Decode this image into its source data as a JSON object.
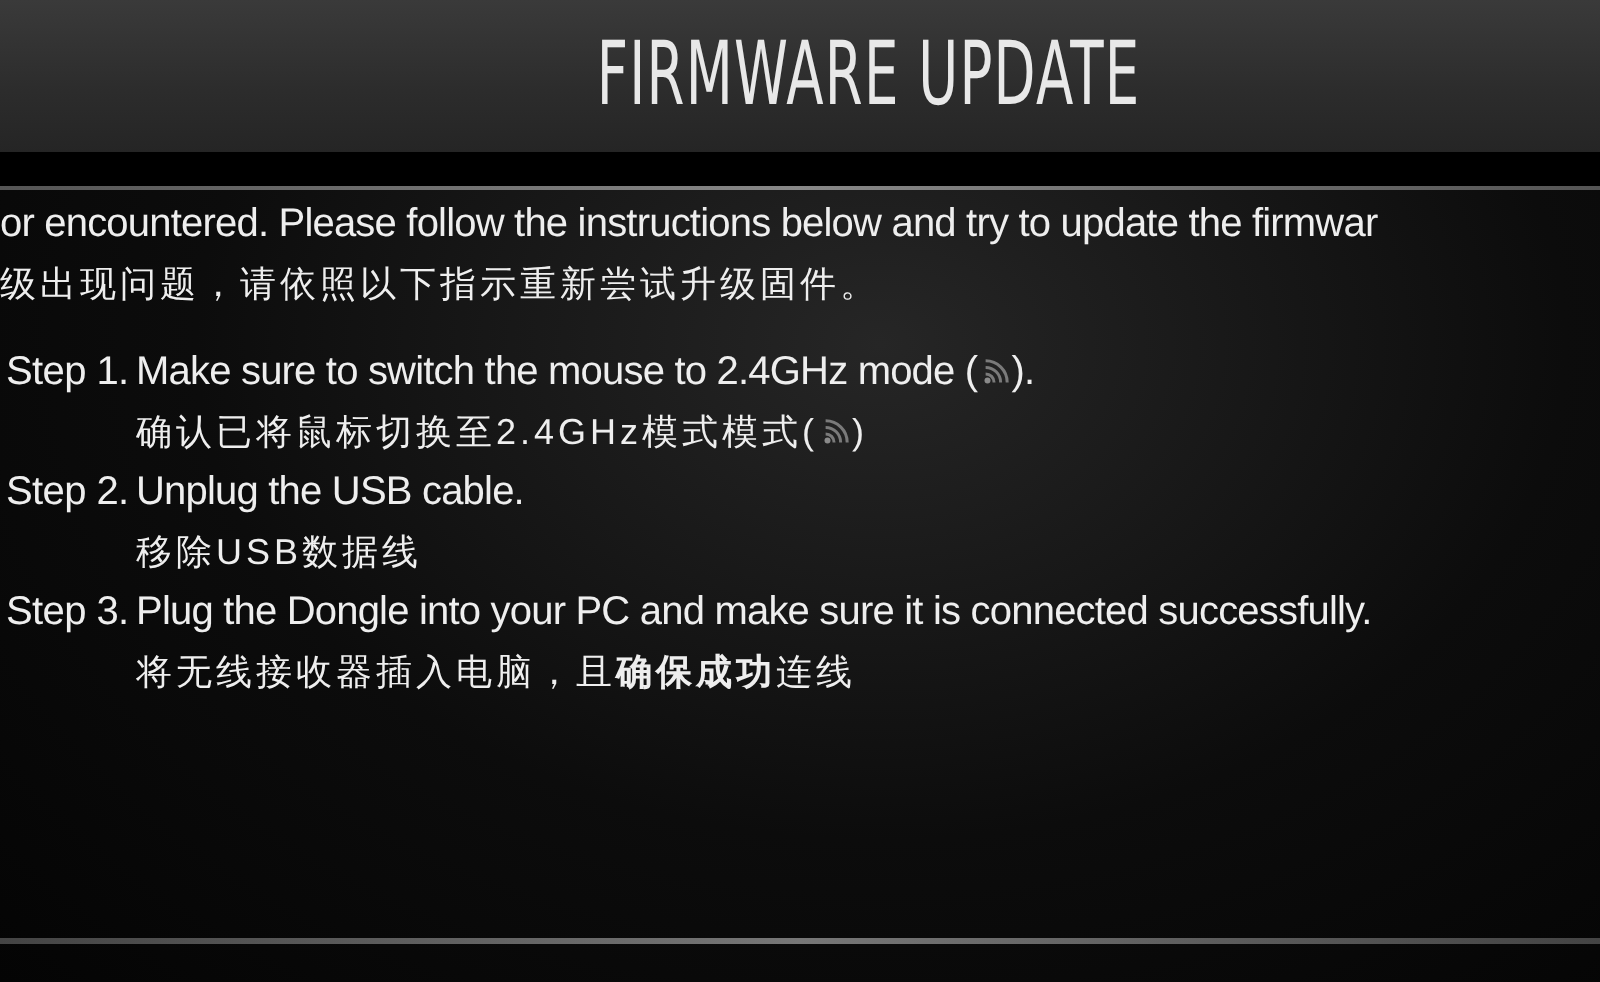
{
  "title": "FIRMWARE UPDATE",
  "intro": {
    "en": "or encountered. Please follow the instructions below and try to update the firmwar",
    "zh": "级出现问题，请依照以下指示重新尝试升级固件。"
  },
  "steps": [
    {
      "label": "Step 1.",
      "en": [
        "Make sure to switch the mouse to 2.4GHz mode (",
        "). "
      ],
      "zh": [
        "确认已将鼠标切换至2.4GHz模式模式(",
        ")"
      ]
    },
    {
      "label": "Step 2.",
      "en": [
        "Unplug the USB cable."
      ],
      "zh": [
        "移除USB数据线"
      ]
    },
    {
      "label": "Step 3.",
      "en": [
        "Plug the Dongle into your PC and make sure it is connected successfully."
      ],
      "zh": [
        "将无线接收器插入电脑，且**确保成功**连线"
      ]
    }
  ]
}
